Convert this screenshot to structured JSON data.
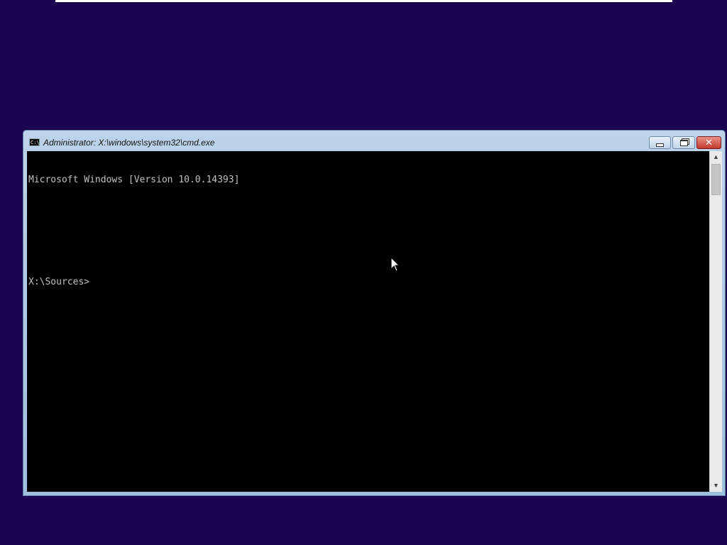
{
  "window": {
    "title": "Administrator: X:\\windows\\system32\\cmd.exe",
    "icon": "cmd-icon",
    "icon_text": "C:\\",
    "controls": {
      "minimize_icon": "minimize-icon",
      "maximize_icon": "maximize-icon",
      "close_icon": "close-icon",
      "close_glyph": "✕"
    }
  },
  "console": {
    "lines": [
      "Microsoft Windows [Version 10.0.14393]",
      "",
      "",
      "X:\\Sources>"
    ]
  },
  "scrollbar": {
    "up_glyph": "▲",
    "down_glyph": "▼"
  },
  "colors": {
    "desktop_background": "#1b0550",
    "console_background": "#000000",
    "console_text": "#c0c0c0",
    "close_button": "#c5392f"
  }
}
